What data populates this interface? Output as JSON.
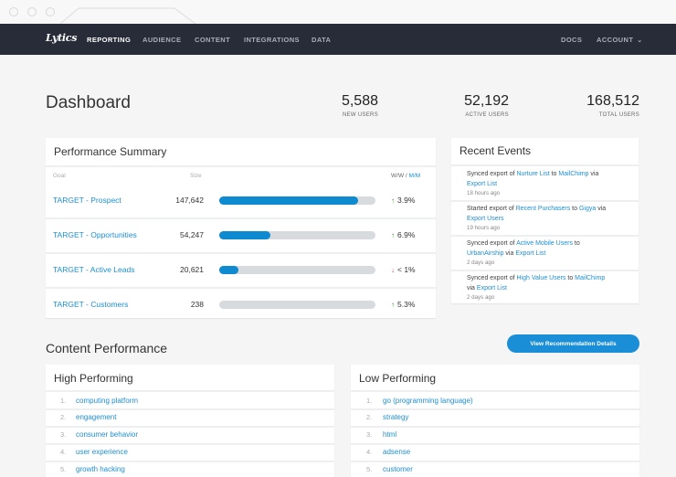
{
  "nav": {
    "logo": "Lytics",
    "items": [
      {
        "label": "REPORTING",
        "active": true
      },
      {
        "label": "AUDIENCE",
        "active": false
      },
      {
        "label": "CONTENT",
        "active": false
      },
      {
        "label": "INTEGRATIONS",
        "active": false
      },
      {
        "label": "DATA",
        "active": false
      }
    ],
    "docs": "DOCS",
    "account": "ACCOUNT",
    "account_caret": "⌄"
  },
  "header": {
    "title": "Dashboard",
    "stats": [
      {
        "value": "5,588",
        "label": "NEW USERS"
      },
      {
        "value": "52,192",
        "label": "ACTIVE USERS"
      },
      {
        "value": "168,512",
        "label": "TOTAL USERS"
      }
    ]
  },
  "performance_summary": {
    "title": "Performance Summary",
    "columns": {
      "goal": "Goal",
      "size": "Size",
      "ww": "W/W / ",
      "mm": "M/M"
    },
    "rows": [
      {
        "goal": "TARGET - Prospect",
        "size": "147,642",
        "progress": 0.89,
        "direction": "up",
        "arrow": "↑",
        "change": "3.9%"
      },
      {
        "goal": "TARGET - Opportunities",
        "size": "54,247",
        "progress": 0.33,
        "direction": "up",
        "arrow": "↑",
        "change": "6.9%"
      },
      {
        "goal": "TARGET - Active Leads",
        "size": "20,621",
        "progress": 0.12,
        "direction": "down",
        "arrow": "↓",
        "change": "< 1%"
      },
      {
        "goal": "TARGET - Customers",
        "size": "238",
        "progress": 0.0,
        "direction": "up",
        "arrow": "↑",
        "change": "5.3%"
      }
    ]
  },
  "recent_events": {
    "title": "Recent Events",
    "items": [
      {
        "t1": "Synced export of ",
        "l1": "Nurture List",
        "t2": " to ",
        "l2": "MailChimp",
        "t3": " via ",
        "l3": "Export List",
        "time": "18 hours ago"
      },
      {
        "t1": "Started export of ",
        "l1": "Recent Purchasers",
        "t2": " to ",
        "l2": "Gigya",
        "t3": " via ",
        "l3": "Export Users",
        "time": "19 hours ago"
      },
      {
        "t1": "Synced export of ",
        "l1": "Active Mobile Users",
        "t2": " to ",
        "l2": "UrbanAirship",
        "t3": " via ",
        "l3": "Export List",
        "time": "2 days ago"
      },
      {
        "t1": "Synced export of ",
        "l1": "High Value Users",
        "t2": " to ",
        "l2": "MailChimp",
        "t3": " via ",
        "l3": "Export List",
        "time": "2 days ago"
      }
    ]
  },
  "content_performance": {
    "title": "Content Performance",
    "button_label": "View Recommendation Details",
    "high": {
      "title": "High Performing",
      "items": [
        {
          "index": "1.",
          "label": "computing platform"
        },
        {
          "index": "2.",
          "label": "engagement"
        },
        {
          "index": "3.",
          "label": "consumer behavior"
        },
        {
          "index": "4.",
          "label": "user experience"
        },
        {
          "index": "5.",
          "label": "growth hacking"
        }
      ]
    },
    "low": {
      "title": "Low Performing",
      "items": [
        {
          "index": "1.",
          "label": "go (programming language)"
        },
        {
          "index": "2.",
          "label": "strategy"
        },
        {
          "index": "3.",
          "label": "html"
        },
        {
          "index": "4.",
          "label": "adsense"
        },
        {
          "index": "5.",
          "label": "customer"
        }
      ]
    }
  },
  "colors": {
    "accent": "#1e8fd1",
    "bar_fill": "#0d8ad0",
    "bar_track": "#d8dbde",
    "nav_bg": "#272c38",
    "up": "#33a02c",
    "down": "#d9534f"
  }
}
